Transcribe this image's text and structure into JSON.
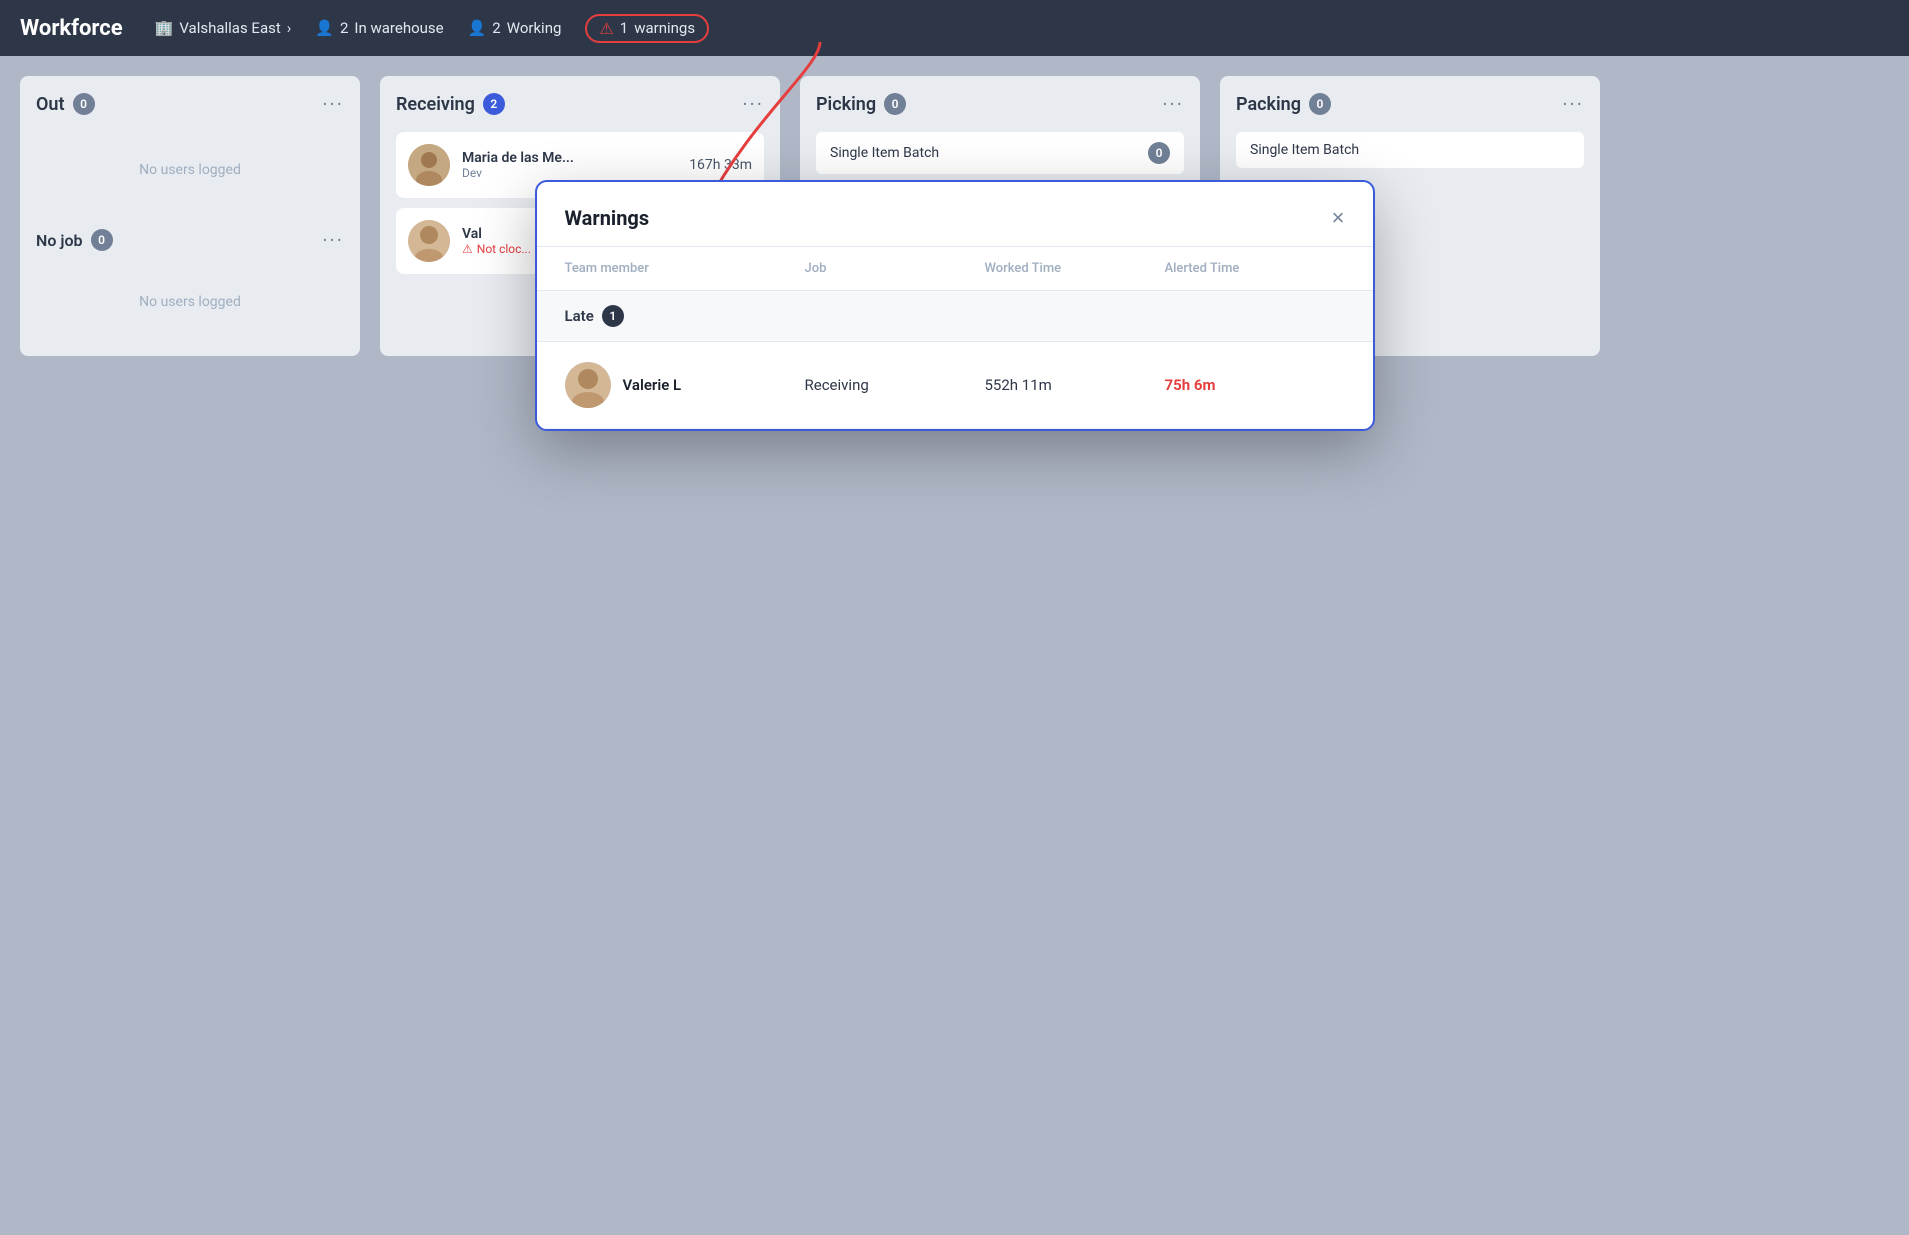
{
  "topbar": {
    "title": "Workforce",
    "location": "Valshallas East",
    "in_warehouse_count": "2",
    "in_warehouse_label": "In warehouse",
    "working_count": "2",
    "working_label": "Working",
    "warnings_count": "1",
    "warnings_label": "warnings"
  },
  "columns": {
    "out": {
      "title": "Out",
      "badge": "0",
      "empty": "No users logged"
    },
    "receiving": {
      "title": "Receiving",
      "badge": "2",
      "users": [
        {
          "name": "Maria de las Me...",
          "role": "Dev",
          "time": "167h 33m"
        },
        {
          "name": "Val",
          "warning": "Not cloc..."
        }
      ]
    },
    "picking": {
      "title": "Picking",
      "badge": "0",
      "sub_items": [
        {
          "label": "Single Item Batch",
          "badge": "0"
        }
      ]
    },
    "packing": {
      "title": "Packing",
      "badge": "0",
      "sub_items": [
        {
          "label": "Single Item Batch",
          "badge": ""
        }
      ]
    }
  },
  "no_job": {
    "title": "No job",
    "badge": "0",
    "empty": "No users logged"
  },
  "modal": {
    "title": "Warnings",
    "close_label": "×",
    "table_headers": {
      "team_member": "Team member",
      "job": "Job",
      "worked_time": "Worked Time",
      "alerted_time": "Alerted Time"
    },
    "sections": {
      "late": {
        "label": "Late",
        "badge": "1",
        "rows": [
          {
            "name": "Valerie L",
            "job": "Receiving",
            "worked_time": "552h 11m",
            "alerted_time": "75h 6m"
          }
        ]
      }
    }
  }
}
